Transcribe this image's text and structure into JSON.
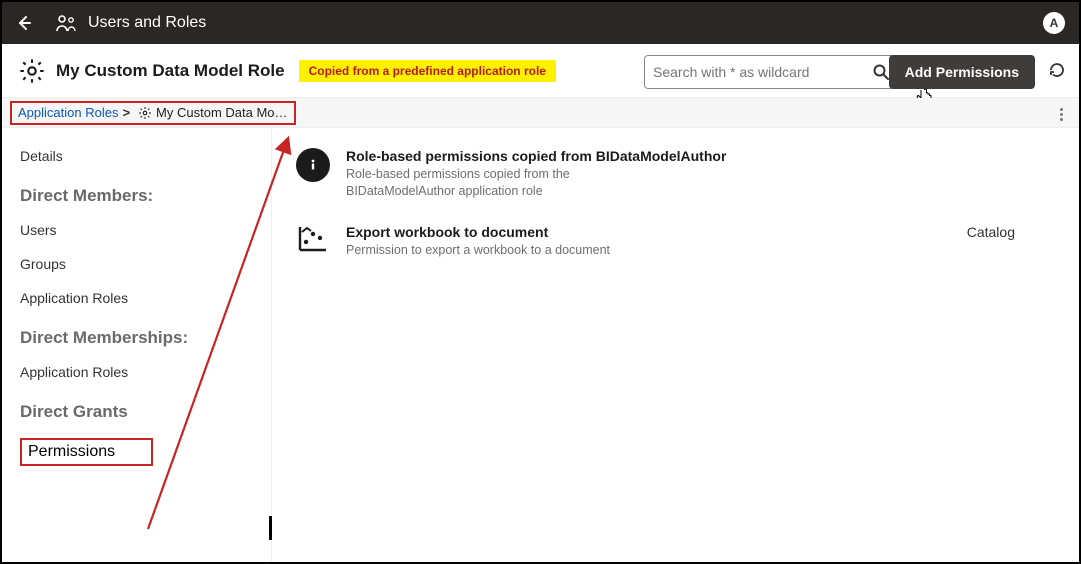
{
  "topbar": {
    "title": "Users and Roles",
    "avatar_letter": "A"
  },
  "subheader": {
    "title": "My Custom Data Model Role",
    "highlight_note": "Copied from a predefined application role",
    "search_placeholder": "Search with * as wildcard",
    "add_permissions_label": "Add Permissions"
  },
  "breadcrumb": {
    "root": "Application Roles",
    "separator": ">",
    "current": "My Custom Data Mo…"
  },
  "sidebar": {
    "details": "Details",
    "section_members": "Direct Members:",
    "users": "Users",
    "groups": "Groups",
    "app_roles_1": "Application Roles",
    "section_memberships": "Direct Memberships:",
    "app_roles_2": "Application Roles",
    "section_grants": "Direct Grants",
    "permissions": "Permissions"
  },
  "permissions": [
    {
      "title": "Role-based permissions copied from BIDataModelAuthor",
      "desc": "Role-based permissions copied from the BIDataModelAuthor application role",
      "tag": ""
    },
    {
      "title": "Export workbook to document",
      "desc": "Permission to export a workbook to a document",
      "tag": "Catalog"
    }
  ]
}
